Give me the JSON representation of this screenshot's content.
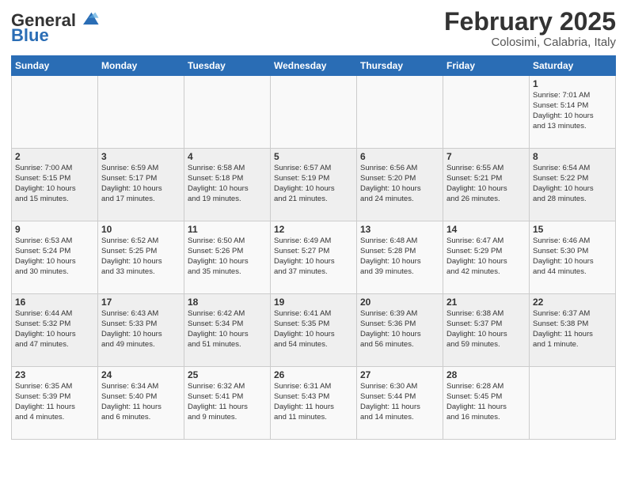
{
  "header": {
    "logo_text_general": "General",
    "logo_text_blue": "Blue",
    "month": "February 2025",
    "location": "Colosimi, Calabria, Italy"
  },
  "weekdays": [
    "Sunday",
    "Monday",
    "Tuesday",
    "Wednesday",
    "Thursday",
    "Friday",
    "Saturday"
  ],
  "weeks": [
    [
      {
        "day": "",
        "info": ""
      },
      {
        "day": "",
        "info": ""
      },
      {
        "day": "",
        "info": ""
      },
      {
        "day": "",
        "info": ""
      },
      {
        "day": "",
        "info": ""
      },
      {
        "day": "",
        "info": ""
      },
      {
        "day": "1",
        "info": "Sunrise: 7:01 AM\nSunset: 5:14 PM\nDaylight: 10 hours\nand 13 minutes."
      }
    ],
    [
      {
        "day": "2",
        "info": "Sunrise: 7:00 AM\nSunset: 5:15 PM\nDaylight: 10 hours\nand 15 minutes."
      },
      {
        "day": "3",
        "info": "Sunrise: 6:59 AM\nSunset: 5:17 PM\nDaylight: 10 hours\nand 17 minutes."
      },
      {
        "day": "4",
        "info": "Sunrise: 6:58 AM\nSunset: 5:18 PM\nDaylight: 10 hours\nand 19 minutes."
      },
      {
        "day": "5",
        "info": "Sunrise: 6:57 AM\nSunset: 5:19 PM\nDaylight: 10 hours\nand 21 minutes."
      },
      {
        "day": "6",
        "info": "Sunrise: 6:56 AM\nSunset: 5:20 PM\nDaylight: 10 hours\nand 24 minutes."
      },
      {
        "day": "7",
        "info": "Sunrise: 6:55 AM\nSunset: 5:21 PM\nDaylight: 10 hours\nand 26 minutes."
      },
      {
        "day": "8",
        "info": "Sunrise: 6:54 AM\nSunset: 5:22 PM\nDaylight: 10 hours\nand 28 minutes."
      }
    ],
    [
      {
        "day": "9",
        "info": "Sunrise: 6:53 AM\nSunset: 5:24 PM\nDaylight: 10 hours\nand 30 minutes."
      },
      {
        "day": "10",
        "info": "Sunrise: 6:52 AM\nSunset: 5:25 PM\nDaylight: 10 hours\nand 33 minutes."
      },
      {
        "day": "11",
        "info": "Sunrise: 6:50 AM\nSunset: 5:26 PM\nDaylight: 10 hours\nand 35 minutes."
      },
      {
        "day": "12",
        "info": "Sunrise: 6:49 AM\nSunset: 5:27 PM\nDaylight: 10 hours\nand 37 minutes."
      },
      {
        "day": "13",
        "info": "Sunrise: 6:48 AM\nSunset: 5:28 PM\nDaylight: 10 hours\nand 39 minutes."
      },
      {
        "day": "14",
        "info": "Sunrise: 6:47 AM\nSunset: 5:29 PM\nDaylight: 10 hours\nand 42 minutes."
      },
      {
        "day": "15",
        "info": "Sunrise: 6:46 AM\nSunset: 5:30 PM\nDaylight: 10 hours\nand 44 minutes."
      }
    ],
    [
      {
        "day": "16",
        "info": "Sunrise: 6:44 AM\nSunset: 5:32 PM\nDaylight: 10 hours\nand 47 minutes."
      },
      {
        "day": "17",
        "info": "Sunrise: 6:43 AM\nSunset: 5:33 PM\nDaylight: 10 hours\nand 49 minutes."
      },
      {
        "day": "18",
        "info": "Sunrise: 6:42 AM\nSunset: 5:34 PM\nDaylight: 10 hours\nand 51 minutes."
      },
      {
        "day": "19",
        "info": "Sunrise: 6:41 AM\nSunset: 5:35 PM\nDaylight: 10 hours\nand 54 minutes."
      },
      {
        "day": "20",
        "info": "Sunrise: 6:39 AM\nSunset: 5:36 PM\nDaylight: 10 hours\nand 56 minutes."
      },
      {
        "day": "21",
        "info": "Sunrise: 6:38 AM\nSunset: 5:37 PM\nDaylight: 10 hours\nand 59 minutes."
      },
      {
        "day": "22",
        "info": "Sunrise: 6:37 AM\nSunset: 5:38 PM\nDaylight: 11 hours\nand 1 minute."
      }
    ],
    [
      {
        "day": "23",
        "info": "Sunrise: 6:35 AM\nSunset: 5:39 PM\nDaylight: 11 hours\nand 4 minutes."
      },
      {
        "day": "24",
        "info": "Sunrise: 6:34 AM\nSunset: 5:40 PM\nDaylight: 11 hours\nand 6 minutes."
      },
      {
        "day": "25",
        "info": "Sunrise: 6:32 AM\nSunset: 5:41 PM\nDaylight: 11 hours\nand 9 minutes."
      },
      {
        "day": "26",
        "info": "Sunrise: 6:31 AM\nSunset: 5:43 PM\nDaylight: 11 hours\nand 11 minutes."
      },
      {
        "day": "27",
        "info": "Sunrise: 6:30 AM\nSunset: 5:44 PM\nDaylight: 11 hours\nand 14 minutes."
      },
      {
        "day": "28",
        "info": "Sunrise: 6:28 AM\nSunset: 5:45 PM\nDaylight: 11 hours\nand 16 minutes."
      },
      {
        "day": "",
        "info": ""
      }
    ]
  ]
}
